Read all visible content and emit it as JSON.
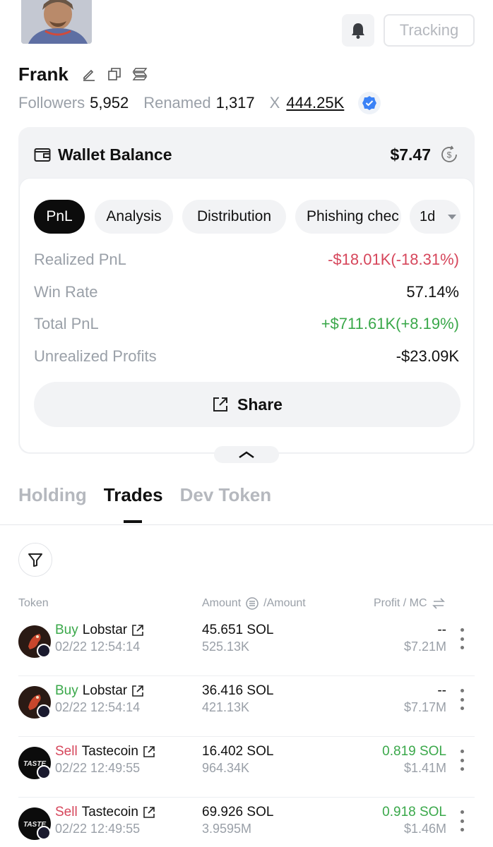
{
  "header": {
    "tracking_label": "Tracking"
  },
  "profile": {
    "name": "Frank",
    "followers_label": "Followers",
    "followers_value": "5,952",
    "renamed_label": "Renamed",
    "renamed_value": "1,317",
    "x_label": "X",
    "x_value": "444.25K"
  },
  "wallet": {
    "title": "Wallet Balance",
    "balance": "$7.47",
    "tabs": [
      "PnL",
      "Analysis",
      "Distribution",
      "Phishing chec"
    ],
    "period": "1d",
    "metrics": [
      {
        "label": "Realized PnL",
        "value": "-$18.01K(-18.31%)",
        "tone": "neg"
      },
      {
        "label": "Win Rate",
        "value": "57.14%",
        "tone": "neutral"
      },
      {
        "label": "Total PnL",
        "value": "+$711.61K(+8.19%)",
        "tone": "pos"
      },
      {
        "label": "Unrealized Profits",
        "value": "-$23.09K",
        "tone": "neutral"
      }
    ],
    "share_label": "Share"
  },
  "tabs": {
    "holding": "Holding",
    "trades": "Trades",
    "dev_token": "Dev Token"
  },
  "table": {
    "col_token": "Token",
    "col_amount": "Amount",
    "col_amount2": "/Amount",
    "col_profit": "Profit / MC",
    "rows": [
      {
        "side": "Buy",
        "token": "Lobstar",
        "time": "02/22 12:54:14",
        "amount": "45.651 SOL",
        "amount2": "525.13K",
        "profit": "--",
        "mc": "$7.21M"
      },
      {
        "side": "Buy",
        "token": "Lobstar",
        "time": "02/22 12:54:14",
        "amount": "36.416 SOL",
        "amount2": "421.13K",
        "profit": "--",
        "mc": "$7.17M"
      },
      {
        "side": "Sell",
        "token": "Tastecoin",
        "time": "02/22 12:49:55",
        "amount": "16.402 SOL",
        "amount2": "964.34K",
        "profit": "0.819 SOL",
        "mc": "$1.41M"
      },
      {
        "side": "Sell",
        "token": "Tastecoin",
        "time": "02/22 12:49:55",
        "amount": "69.926 SOL",
        "amount2": "3.9595M",
        "profit": "0.918 SOL",
        "mc": "$1.46M"
      }
    ]
  },
  "colors": {
    "positive": "#3aa84a",
    "negative": "#d6465b",
    "muted": "#9aa0a8",
    "surface": "#f2f3f5"
  }
}
